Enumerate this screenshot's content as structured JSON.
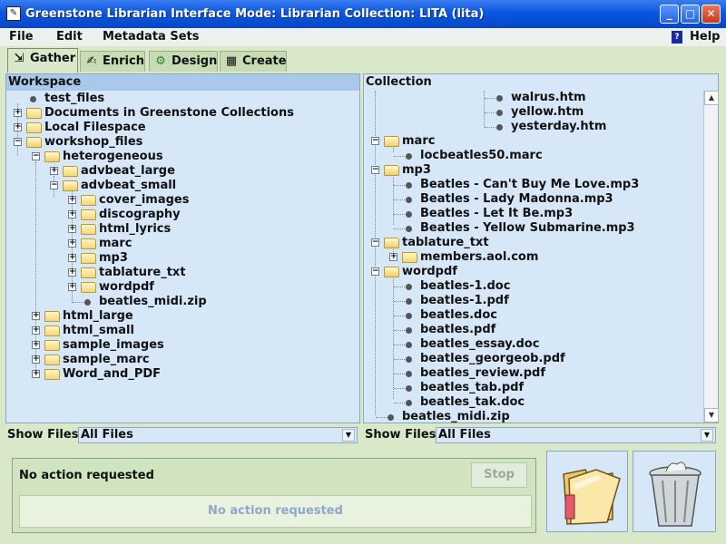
{
  "window": {
    "title": "Greenstone Librarian Interface  Mode: Librarian  Collection: LITA (lita)",
    "minimize_label": "_",
    "maximize_label": "□",
    "close_label": "✕"
  },
  "menu": {
    "items": [
      "File",
      "Edit",
      "Metadata Sets"
    ],
    "help": "Help"
  },
  "tabs": [
    {
      "label": "Gather",
      "icon": "gather-icon"
    },
    {
      "label": "Enrich",
      "icon": "enrich-icon"
    },
    {
      "label": "Design",
      "icon": "design-icon"
    },
    {
      "label": "Create",
      "icon": "create-icon"
    }
  ],
  "workspace": {
    "header": "Workspace",
    "nodes": [
      "test_files",
      "Documents in Greenstone Collections",
      "Local Filespace",
      "workshop_files",
      "heterogeneous",
      "advbeat_large",
      "advbeat_small",
      "cover_images",
      "discography",
      "html_lyrics",
      "marc",
      "mp3",
      "tablature_txt",
      "wordpdf",
      "beatles_midi.zip",
      "html_large",
      "html_small",
      "sample_images",
      "sample_marc",
      "Word_and_PDF"
    ],
    "show_files_label": "Show Files",
    "show_files_value": "All Files"
  },
  "collection": {
    "header": "Collection",
    "nodes": [
      "walrus.htm",
      "yellow.htm",
      "yesterday.htm",
      "marc",
      "locbeatles50.marc",
      "mp3",
      "Beatles - Can't Buy Me Love.mp3",
      "Beatles - Lady Madonna.mp3",
      "Beatles - Let It Be.mp3",
      "Beatles - Yellow Submarine.mp3",
      "tablature_txt",
      "members.aol.com",
      "wordpdf",
      "beatles-1.doc",
      "beatles-1.pdf",
      "beatles.doc",
      "beatles.pdf",
      "beatles_essay.doc",
      "beatles_georgeob.pdf",
      "beatles_review.pdf",
      "beatles_tab.pdf",
      "beatles_tak.doc",
      "beatles_midi.zip"
    ],
    "show_files_label": "Show Files",
    "show_files_value": "All Files"
  },
  "status": {
    "message": "No action requested",
    "stop_label": "Stop",
    "progress_text": "No action requested"
  }
}
